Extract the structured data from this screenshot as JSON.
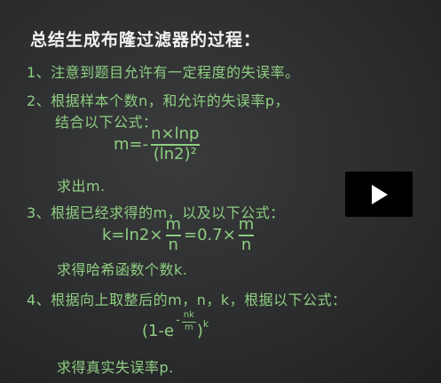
{
  "title": "总结生成布隆过滤器的过程：",
  "items": {
    "item1": "1、注意到题目允许有一定程度的失误率。",
    "item2_line1": "2、根据样本个数n，和允许的失误率p，",
    "item2_line2": "结合以下公式：",
    "formula_m": {
      "lhs": "m=-",
      "numerator": "n×lnp",
      "denominator": "(ln2)²"
    },
    "item2_result": "求出m.",
    "item3": "3、根据已经求得的m，以及以下公式：",
    "formula_k": {
      "lhs": "k=ln2×",
      "frac1_num": "m",
      "frac1_den": "n",
      "mid": "=0.7×",
      "frac2_num": "m",
      "frac2_den": "n"
    },
    "item3_result": "求得哈希函数个数k.",
    "item4": "4、根据向上取整后的m，n，k，根据以下公式：",
    "formula_p": {
      "open": "(1-e",
      "exp_sign": "-",
      "exp_num": "nk",
      "exp_den": "m",
      "close": ")",
      "power": "k"
    },
    "item4_result": "求得真实失误率p."
  },
  "play_button": {
    "icon": "play-icon"
  }
}
